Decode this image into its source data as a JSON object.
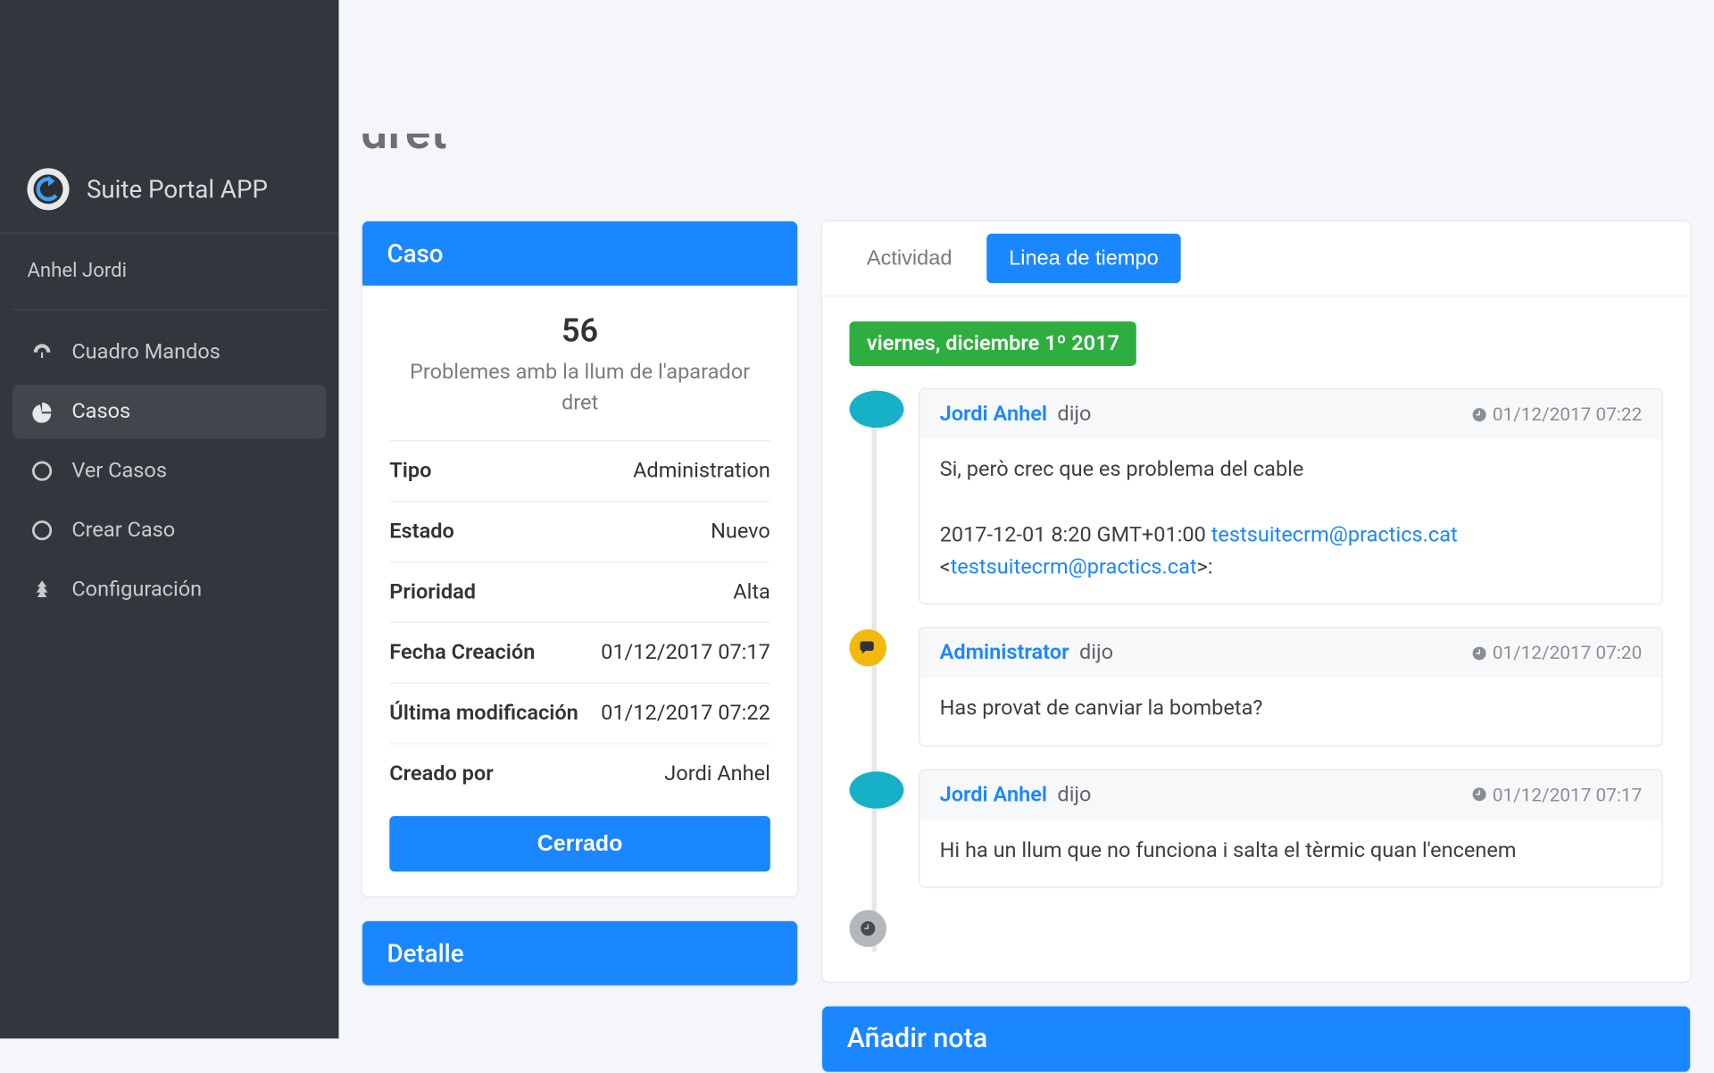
{
  "brand": {
    "title": "Suite Portal APP"
  },
  "user": {
    "name": "Anhel Jordi"
  },
  "page": {
    "title_cut": "dret"
  },
  "sidebar": {
    "items": [
      {
        "label": "Cuadro Mandos",
        "icon": "dashboard-icon",
        "active": false
      },
      {
        "label": "Casos",
        "icon": "pie-icon",
        "active": true
      },
      {
        "label": "Ver Casos",
        "icon": "circle-o-icon",
        "active": false
      },
      {
        "label": "Crear Caso",
        "icon": "circle-o-icon",
        "active": false
      },
      {
        "label": "Configuración",
        "icon": "tree-icon",
        "active": false
      }
    ]
  },
  "case_card": {
    "header": "Caso",
    "number": "56",
    "title": "Problemes amb la llum de l'aparador dret",
    "rows": {
      "type": {
        "label": "Tipo",
        "value": "Administration"
      },
      "status": {
        "label": "Estado",
        "value": "Nuevo"
      },
      "priority": {
        "label": "Prioridad",
        "value": "Alta"
      },
      "created": {
        "label": "Fecha Creación",
        "value": "01/12/2017 07:17"
      },
      "modified": {
        "label": "Última modificación",
        "value": "01/12/2017 07:22"
      },
      "creator": {
        "label": "Creado por",
        "value": "Jordi Anhel"
      }
    },
    "close_button": "Cerrado"
  },
  "detail_card": {
    "header": "Detalle"
  },
  "tabs": {
    "activity": "Actividad",
    "timeline": "Linea de tiempo"
  },
  "timeline": {
    "date_badge": "viernes, diciembre 1º 2017",
    "said_word": "dijo",
    "items": [
      {
        "kind": "user",
        "author": "Jordi Anhel",
        "time": "01/12/2017 07:22",
        "body_pre": "Si, però crec que es problema del cable",
        "body_mid": "2017-12-01 8:20 GMT+01:00 ",
        "link1": "testsuitecrm@practics.cat",
        "body_after1": " <",
        "link2": "testsuitecrm@practics.cat",
        "body_after2": ">:"
      },
      {
        "kind": "admin",
        "author": "Administrator",
        "time": "01/12/2017 07:20",
        "body": "Has provat de canviar la bombeta?"
      },
      {
        "kind": "user",
        "author": "Jordi Anhel",
        "time": "01/12/2017 07:17",
        "body": "Hi ha un llum que no funciona i salta el tèrmic quan l'encenem"
      }
    ]
  },
  "add_note": {
    "header": "Añadir nota"
  }
}
